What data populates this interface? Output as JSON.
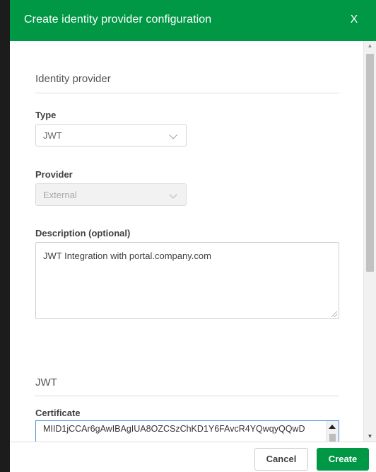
{
  "dialog": {
    "title": "Create identity provider configuration",
    "close_label": "X"
  },
  "identity_provider_section": {
    "title": "Identity provider",
    "type": {
      "label": "Type",
      "value": "JWT"
    },
    "provider": {
      "label": "Provider",
      "value": "External",
      "disabled": true
    },
    "description": {
      "label": "Description (optional)",
      "value": "JWT Integration with portal.company.com"
    }
  },
  "jwt_section": {
    "title": "JWT",
    "certificate": {
      "label": "Certificate",
      "value": "MIID1jCCAr6gAwIBAgIUA8OZCSzChKD1Y6FAvcR4YQwqyQQwD"
    }
  },
  "footer": {
    "cancel_label": "Cancel",
    "create_label": "Create"
  },
  "colors": {
    "brand_green": "#009845",
    "focus_blue": "#4a90e2"
  },
  "icons": {
    "close": "close-icon",
    "dropdown": "chevron-down-icon",
    "scroll_up": "scroll-up-arrow-icon",
    "scroll_down": "scroll-down-arrow-icon",
    "resize": "resize-grip-icon"
  }
}
